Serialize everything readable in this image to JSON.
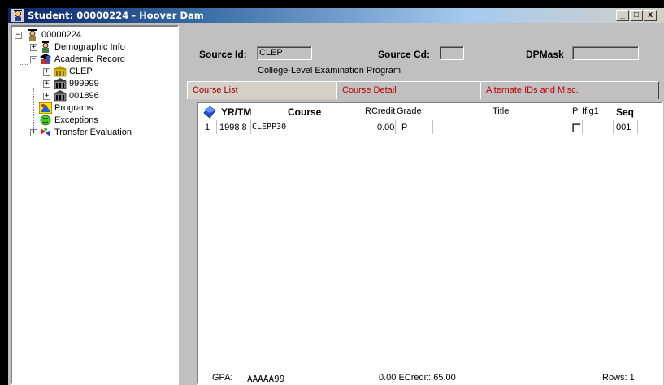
{
  "window": {
    "title": "Student: 00000224 - Hoover Dam",
    "minimize": "_",
    "maximize": "□",
    "close": "x"
  },
  "tree": {
    "root": "00000224",
    "items": [
      {
        "label": "Demographic Info"
      },
      {
        "label": "Academic Record"
      },
      {
        "label": "CLEP"
      },
      {
        "label": "999999"
      },
      {
        "label": "001896"
      },
      {
        "label": "Programs"
      },
      {
        "label": "Exceptions"
      },
      {
        "label": "Transfer Evaluation"
      }
    ]
  },
  "header": {
    "source_id_label": "Source Id:",
    "source_id_value": "CLEP",
    "source_cd_label": "Source Cd:",
    "source_cd_value": "",
    "dpmask_label": "DPMask",
    "dpmask_value": "",
    "description": "College-Level Examination Program"
  },
  "tabs": [
    {
      "label": "Course List"
    },
    {
      "label": "Course Detail"
    },
    {
      "label": "Alternate IDs and Misc."
    }
  ],
  "grid": {
    "columns": {
      "yrtm": "YR/TM",
      "course": "Course",
      "rcredit": "RCredit",
      "grade": "Grade",
      "title": "Title",
      "p": "P",
      "ifig1": "Ifig1",
      "seq": "Seq"
    },
    "rows": [
      {
        "num": "1",
        "yrtm": "1998 8",
        "course": "CLEPP30",
        "rcredit": "0.00",
        "grade": "P",
        "title": "",
        "p_checked": false,
        "ifig1": "",
        "seq": "001"
      }
    ]
  },
  "footer": {
    "gpa_label": "GPA:",
    "gpa_code": "AAAAA99",
    "credit_text": "0.00 ECredit: 65.00",
    "rows_text": "Rows: 1"
  },
  "icons": {
    "title_icon": "student-icon",
    "grid_corner": "book-icon"
  },
  "colors": {
    "title_active": "#0a246a",
    "tab_text": "#c00000",
    "window_face": "#c0c0c0"
  }
}
